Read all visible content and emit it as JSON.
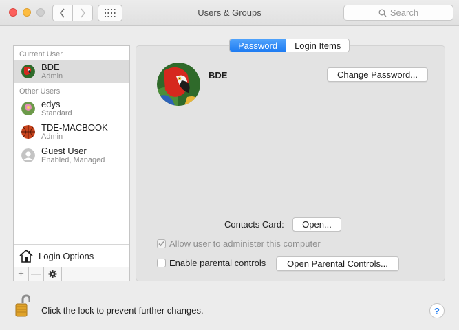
{
  "window": {
    "title": "Users & Groups"
  },
  "toolbar": {
    "search_placeholder": "Search"
  },
  "sidebar": {
    "current_header": "Current User",
    "other_header": "Other Users",
    "users": [
      {
        "name": "BDE",
        "role": "Admin",
        "avatar": "parrot-icon"
      },
      {
        "name": "edys",
        "role": "Standard",
        "avatar": "flower-icon"
      },
      {
        "name": "TDE-MACBOOK",
        "role": "Admin",
        "avatar": "basketball-icon"
      },
      {
        "name": "Guest User",
        "role": "Enabled, Managed",
        "avatar": "person-silhouette-icon"
      }
    ],
    "login_options_label": "Login Options",
    "add_label": "+",
    "remove_label": "—"
  },
  "tabs": [
    {
      "label": "Password",
      "active": true
    },
    {
      "label": "Login Items",
      "active": false
    }
  ],
  "detail": {
    "name": "BDE",
    "change_password_label": "Change Password...",
    "contacts_card_label": "Contacts Card:",
    "open_label": "Open...",
    "allow_admin_label": "Allow user to administer this computer",
    "allow_admin_checked": true,
    "allow_admin_enabled": false,
    "parental_label": "Enable parental controls",
    "parental_checked": false,
    "open_parental_label": "Open Parental Controls..."
  },
  "footer": {
    "lock_text": "Click the lock to prevent further changes.",
    "help_label": "?"
  },
  "colors": {
    "accent": "#1f7cf2",
    "selection": "#dcdcdc",
    "window_bg": "#ececec"
  }
}
